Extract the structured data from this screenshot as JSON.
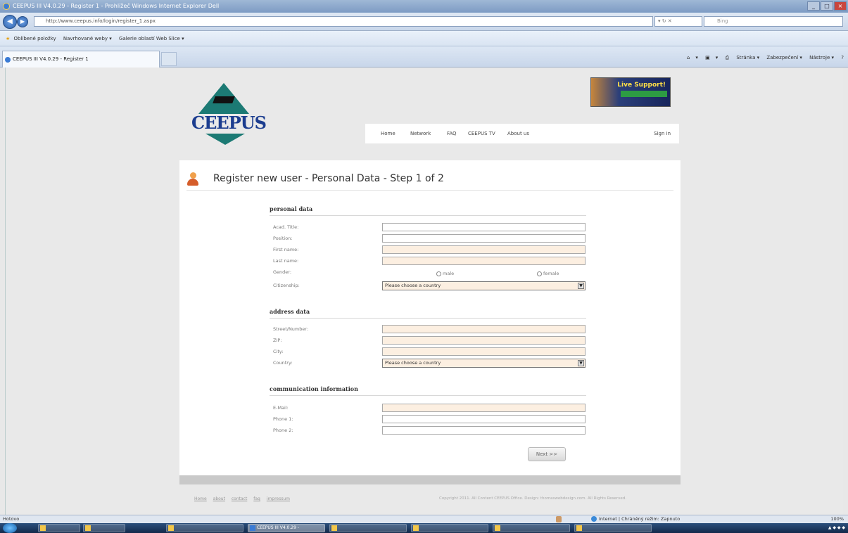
{
  "browser": {
    "title": "CEEPUS III V4.0.29 - Register 1 - Prohlížeč Windows Internet Explorer Dell",
    "url": "http://www.ceepus.info/login/register_1.aspx",
    "search_placeholder": "Bing",
    "favorites_label": "Oblíbené položky",
    "fav_items": [
      "Navrhované weby ▾",
      "Galerie oblastí Web Slice ▾"
    ],
    "tab_label": "CEEPUS III V4.0.29 - Register 1",
    "cmd_items": [
      "▾",
      "▾",
      "Stránka ▾",
      "Zabezpečení ▾",
      "Nástroje ▾"
    ]
  },
  "site": {
    "logo_text": "CEEPUS",
    "live_support": "Live Support!",
    "nav": [
      "Home",
      "Network",
      "FAQ",
      "CEEPUS TV",
      "About us"
    ],
    "sign_in": "Sign in"
  },
  "page": {
    "title": "Register new user - Personal Data - Step 1 of 2",
    "sections": {
      "personal": "personal data",
      "address": "address data",
      "communication": "communication information"
    },
    "labels": {
      "acad_title": "Acad. Title:",
      "position": "Position:",
      "first_name": "First name:",
      "last_name": "Last name:",
      "gender": "Gender:",
      "citizenship": "Citizenship:",
      "street": "Street/Number:",
      "zip": "ZIP:",
      "city": "City:",
      "country": "Country:",
      "email": "E-Mail:",
      "phone1": "Phone 1:",
      "phone2": "Phone 2:"
    },
    "gender_options": [
      "male",
      "female"
    ],
    "country_placeholder": "Please choose a country",
    "next_button": "Next >>"
  },
  "footer": {
    "links": [
      "Home",
      "about",
      "contact",
      "faq",
      "impressum"
    ],
    "copyright": "Copyright 2011. All Content CEEPUS Office. Design: thomaswebdesign.com. All Rights Reserved."
  },
  "statusbar": {
    "left": "Hotovo",
    "zone": "Internet | Chráněný režim: Zapnuto",
    "zoom": "100%"
  },
  "taskbar": {
    "tasks": [
      "",
      "",
      "CEEPUS III V4.0.29 -",
      "",
      "",
      "",
      ""
    ]
  }
}
